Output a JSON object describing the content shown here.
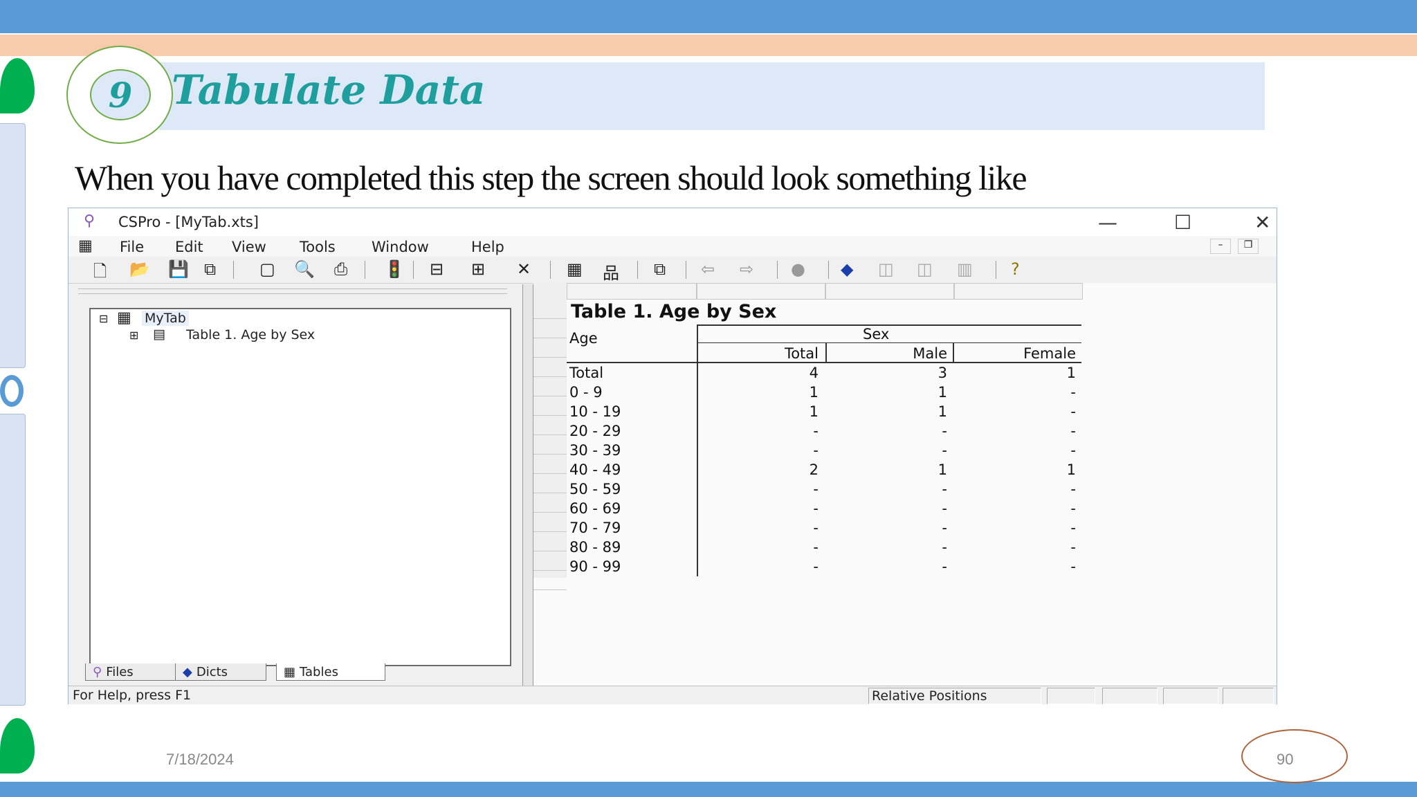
{
  "slide": {
    "step_number": "9",
    "title": "Tabulate Data",
    "subtitle": "When you have completed this step the screen should look something like",
    "date": "7/18/2024",
    "page_number": "90",
    "colors": {
      "accent_blue": "#5b9bd5",
      "peach": "#f8cbad",
      "teal_title": "#1f9e9e",
      "green_leaf": "#00b050"
    }
  },
  "window": {
    "title": "CSPro - [MyTab.xts]",
    "controls": {
      "minimize": "—",
      "maximize": "☐",
      "close": "✕"
    },
    "menu": [
      "File",
      "Edit",
      "View",
      "Tools",
      "Window",
      "Help"
    ],
    "toolbar_icons": [
      "new-icon",
      "open-icon",
      "save-icon",
      "save-all-icon",
      "window-icon",
      "print-preview-icon",
      "print-icon",
      "run-icon",
      "add-row-icon",
      "add-column-icon",
      "delete-icon",
      "grid-icon",
      "tree-icon",
      "copy-icon",
      "back-icon",
      "forward-icon",
      "stop-icon",
      "book-icon",
      "layers-icon",
      "layers2-icon",
      "layers3-icon",
      "help-icon"
    ],
    "tree": {
      "root": "MyTab",
      "child": "Table 1. Age by Sex",
      "tabs": [
        "Files",
        "Dicts",
        "Tables"
      ]
    },
    "status": {
      "help": "For Help, press F1",
      "mode": "Relative Positions"
    }
  },
  "table": {
    "title": "Table 1. Age by Sex",
    "stub_header": "Age",
    "spanner": "Sex",
    "columns": [
      "Total",
      "Male",
      "Female"
    ],
    "rows": [
      {
        "label": "Total",
        "values": [
          "4",
          "3",
          "1"
        ]
      },
      {
        "label": "0 - 9",
        "values": [
          "1",
          "1",
          "-"
        ]
      },
      {
        "label": "10 - 19",
        "values": [
          "1",
          "1",
          "-"
        ]
      },
      {
        "label": "20 - 29",
        "values": [
          "-",
          "-",
          "-"
        ]
      },
      {
        "label": "30 - 39",
        "values": [
          "-",
          "-",
          "-"
        ]
      },
      {
        "label": "40 - 49",
        "values": [
          "2",
          "1",
          "1"
        ]
      },
      {
        "label": "50 - 59",
        "values": [
          "-",
          "-",
          "-"
        ]
      },
      {
        "label": "60 - 69",
        "values": [
          "-",
          "-",
          "-"
        ]
      },
      {
        "label": "70 - 79",
        "values": [
          "-",
          "-",
          "-"
        ]
      },
      {
        "label": "80 - 89",
        "values": [
          "-",
          "-",
          "-"
        ]
      },
      {
        "label": "90 - 99",
        "values": [
          "-",
          "-",
          "-"
        ]
      }
    ]
  }
}
